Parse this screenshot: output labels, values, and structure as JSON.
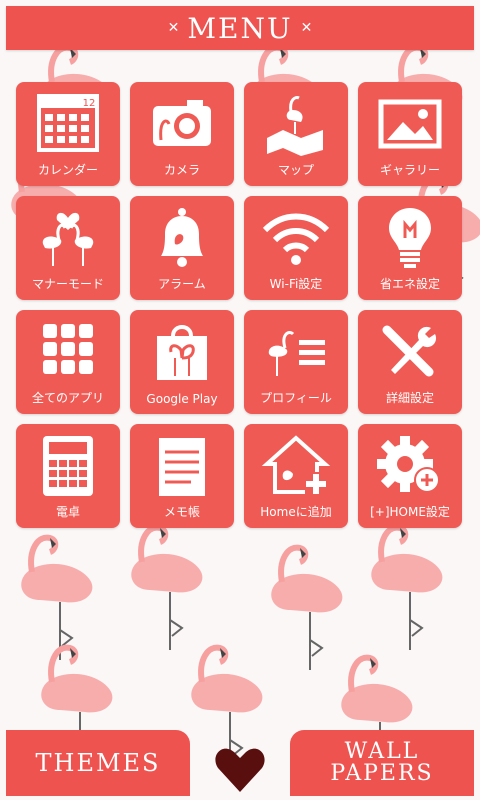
{
  "header": {
    "title": "MENU",
    "deco_left": "✕",
    "deco_right": "✕"
  },
  "apps": [
    {
      "label": "カレンダー",
      "icon": "calendar-icon",
      "day": "12"
    },
    {
      "label": "カメラ",
      "icon": "camera-icon"
    },
    {
      "label": "マップ",
      "icon": "map-icon"
    },
    {
      "label": "ギャラリー",
      "icon": "gallery-icon"
    },
    {
      "label": "マナーモード",
      "icon": "manner-mode-flamingo-heart-icon"
    },
    {
      "label": "アラーム",
      "icon": "alarm-bell-icon"
    },
    {
      "label": "Wi-Fi設定",
      "icon": "wifi-icon"
    },
    {
      "label": "省エネ設定",
      "icon": "lightbulb-icon"
    },
    {
      "label": "全てのアプリ",
      "icon": "app-grid-icon"
    },
    {
      "label": "Google Play",
      "icon": "shopping-bag-icon"
    },
    {
      "label": "プロフィール",
      "icon": "profile-list-icon"
    },
    {
      "label": "詳細設定",
      "icon": "tools-icon"
    },
    {
      "label": "電卓",
      "icon": "calculator-icon"
    },
    {
      "label": "メモ帳",
      "icon": "notepad-icon"
    },
    {
      "label": "Homeに追加",
      "icon": "home-add-icon"
    },
    {
      "label": "[+]HOME設定",
      "icon": "gear-plus-icon"
    }
  ],
  "bottom": {
    "themes": "THEMES",
    "wall_1": "WALL",
    "wall_2": "PAPERS"
  },
  "colors": {
    "accent": "#ef5350",
    "heart": "#5a0f0f"
  }
}
